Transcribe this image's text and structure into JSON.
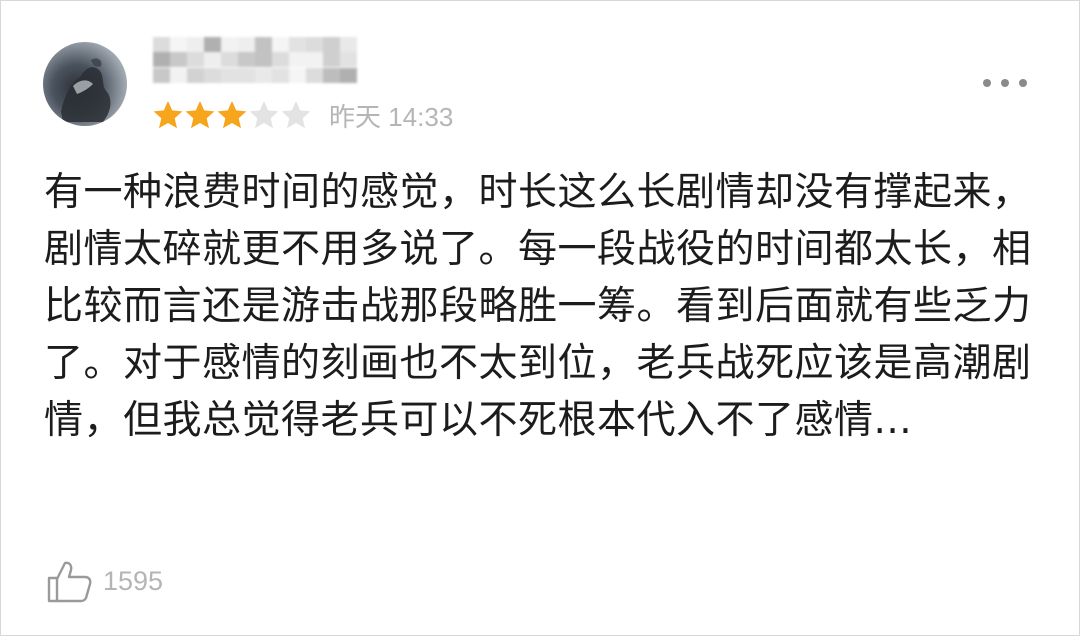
{
  "comment": {
    "username": "",
    "time": "昨天 14:33",
    "rating": {
      "value": 3,
      "max": 5
    },
    "text": "有一种浪费时间的感觉，时长这么长剧情却没有撑起来，剧情太碎就更不用多说了。每一段战役的时间都太长，相比较而言还是游击战那段略胜一筹。看到后面就有些乏力了。对于感情的刻画也不太到位，老兵战死应该是高潮剧情，但我总觉得老兵可以不死根本代入不了感情...",
    "likes": "1595"
  },
  "icons": {
    "more": "more-dots-icon",
    "like": "thumbs-up-icon",
    "star_filled": "star-filled-icon",
    "star_empty": "star-empty-icon"
  },
  "colors": {
    "star_filled": "#f7a51c",
    "star_empty": "#e3e3e3",
    "muted_text": "#b5b5b5",
    "body_text": "#1c1c1c"
  }
}
